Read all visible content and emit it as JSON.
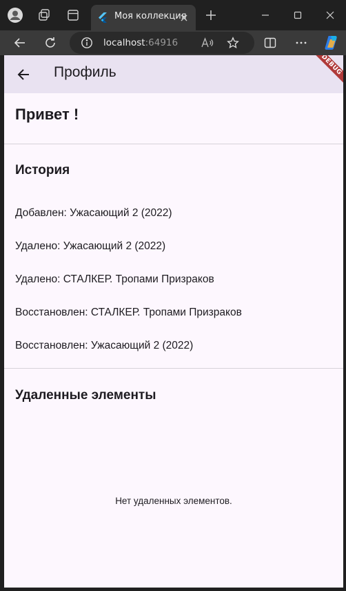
{
  "browser": {
    "tab_title": "Моя коллекция",
    "url_host": "localhost",
    "url_port": ":64916"
  },
  "app": {
    "title": "Профиль",
    "debug_banner": "DEBUG",
    "greeting": "Привет !",
    "history": {
      "title": "История",
      "items": [
        "Добавлен: Ужасающий 2 (2022)",
        "Удалено: Ужасающий 2 (2022)",
        "Удалено: СТАЛКЕР. Тропами Призраков",
        "Восстановлен: СТАЛКЕР. Тропами Призраков",
        "Восстановлен: Ужасающий 2 (2022)"
      ]
    },
    "deleted": {
      "title": "Удаленные элементы",
      "empty_message": "Нет удаленных элементов."
    }
  }
}
